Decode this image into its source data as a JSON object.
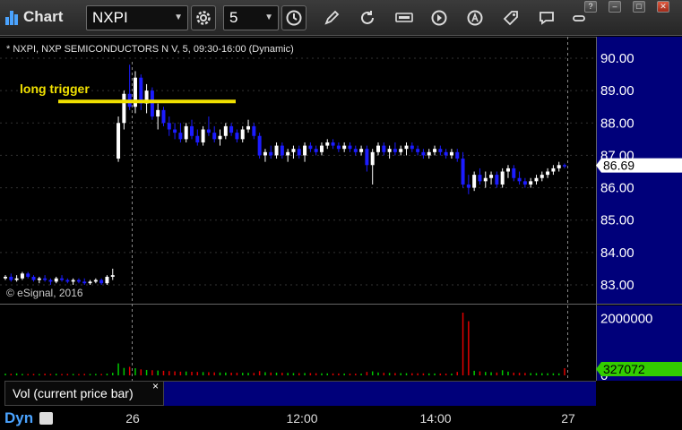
{
  "app": {
    "title": "Chart"
  },
  "toolbar": {
    "symbol": "NXPI",
    "interval": "5",
    "icons": [
      "settings-gear-icon",
      "clock-icon",
      "pencil-draw-icon",
      "refresh-icon",
      "get-data-icon",
      "play-icon",
      "alert-icon",
      "tag-icon",
      "comment-icon"
    ],
    "window_buttons": [
      "?",
      "–",
      "□",
      "✕"
    ]
  },
  "chart": {
    "title": "* NXPI, NXP SEMICONDUCTORS N V, 5, 09:30-16:00 (Dynamic)",
    "copyright": "© eSignal, 2016",
    "annotation": "long trigger",
    "last_price_label": "86.69",
    "last_volume_label": "327072"
  },
  "volume_panel": {
    "label": "Vol (current price bar)",
    "close": "×"
  },
  "bottom": {
    "mode": "Dyn",
    "time_labels": [
      "26",
      "12:00",
      "14:00",
      "27"
    ]
  },
  "colors": {
    "up": "#ffffff",
    "down": "#1c1cff",
    "vol_up": "#00c800",
    "vol_down": "#e00000",
    "annotation": "#f0e000",
    "axis_panel": "#00007a",
    "price_badge": "#ffffff",
    "volume_badge": "#33cc00",
    "accent": "#4aa3ff"
  },
  "chart_data": {
    "type": "candlestick",
    "y_ticks": [
      90.0,
      89.0,
      88.0,
      87.0,
      86.0,
      85.0,
      84.0,
      83.0
    ],
    "y_tick_labels": [
      "90.00",
      "89.00",
      "88.00",
      "87.00",
      "86.00",
      "85.00",
      "84.00",
      "83.00"
    ],
    "ylim": [
      82.5,
      90.6
    ],
    "x_labels": [
      "26",
      "12:00",
      "14:00",
      "27"
    ],
    "long_trigger_level": 88.5,
    "last_price": 86.69,
    "volume_tick_labels": [
      "2000000",
      "0"
    ],
    "volume_ticks": [
      2000000,
      0
    ],
    "volume_ylim": [
      0,
      2200000
    ],
    "last_volume": 327072,
    "candles": [
      [
        83.2,
        83.3,
        83.15,
        83.25
      ],
      [
        83.25,
        83.35,
        83.1,
        83.15
      ],
      [
        83.15,
        83.3,
        83.1,
        83.2
      ],
      [
        83.2,
        83.4,
        83.15,
        83.35
      ],
      [
        83.35,
        83.4,
        83.2,
        83.25
      ],
      [
        83.25,
        83.3,
        83.1,
        83.15
      ],
      [
        83.15,
        83.25,
        83.05,
        83.2
      ],
      [
        83.2,
        83.3,
        83.1,
        83.15
      ],
      [
        83.15,
        83.2,
        83.0,
        83.1
      ],
      [
        83.1,
        83.25,
        83.05,
        83.2
      ],
      [
        83.2,
        83.3,
        83.1,
        83.15
      ],
      [
        83.15,
        83.2,
        83.05,
        83.1
      ],
      [
        83.1,
        83.2,
        83.0,
        83.15
      ],
      [
        83.15,
        83.2,
        83.05,
        83.1
      ],
      [
        83.1,
        83.2,
        83.0,
        83.05
      ],
      [
        83.05,
        83.15,
        83.0,
        83.1
      ],
      [
        83.1,
        83.2,
        83.05,
        83.15
      ],
      [
        83.15,
        83.2,
        83.0,
        83.05
      ],
      [
        83.05,
        83.3,
        83.0,
        83.25
      ],
      [
        83.25,
        83.5,
        83.15,
        83.3
      ],
      [
        86.9,
        88.2,
        86.8,
        88.0
      ],
      [
        88.0,
        89.0,
        87.8,
        88.9
      ],
      [
        88.9,
        89.8,
        88.4,
        88.5
      ],
      [
        88.5,
        89.6,
        88.3,
        89.4
      ],
      [
        89.4,
        89.5,
        88.4,
        88.6
      ],
      [
        88.6,
        89.2,
        88.3,
        89.0
      ],
      [
        89.0,
        89.1,
        88.1,
        88.2
      ],
      [
        88.2,
        88.6,
        87.8,
        88.4
      ],
      [
        88.4,
        88.5,
        87.9,
        88.0
      ],
      [
        88.0,
        88.2,
        87.6,
        87.8
      ],
      [
        87.8,
        88.0,
        87.5,
        87.7
      ],
      [
        87.7,
        88.0,
        87.4,
        87.5
      ],
      [
        87.5,
        88.0,
        87.4,
        87.9
      ],
      [
        87.9,
        88.1,
        87.5,
        87.6
      ],
      [
        87.6,
        87.8,
        87.3,
        87.4
      ],
      [
        87.4,
        87.9,
        87.3,
        87.8
      ],
      [
        87.8,
        88.2,
        87.6,
        87.7
      ],
      [
        87.7,
        87.9,
        87.4,
        87.5
      ],
      [
        87.5,
        87.8,
        87.3,
        87.6
      ],
      [
        87.6,
        88.0,
        87.5,
        87.9
      ],
      [
        87.9,
        88.0,
        87.6,
        87.7
      ],
      [
        87.7,
        87.8,
        87.4,
        87.5
      ],
      [
        87.5,
        87.9,
        87.4,
        87.8
      ],
      [
        87.8,
        88.1,
        87.7,
        87.9
      ],
      [
        87.9,
        88.0,
        87.5,
        87.6
      ],
      [
        87.6,
        87.7,
        86.9,
        87.0
      ],
      [
        87.0,
        87.2,
        86.8,
        87.1
      ],
      [
        87.1,
        87.3,
        86.9,
        87.0
      ],
      [
        87.0,
        87.4,
        86.9,
        87.3
      ],
      [
        87.3,
        87.4,
        86.9,
        87.0
      ],
      [
        87.0,
        87.2,
        86.8,
        87.1
      ],
      [
        87.1,
        87.3,
        86.9,
        87.2
      ],
      [
        87.2,
        87.3,
        86.9,
        87.0
      ],
      [
        87.0,
        87.4,
        86.8,
        87.3
      ],
      [
        87.3,
        87.4,
        87.1,
        87.2
      ],
      [
        87.2,
        87.3,
        87.0,
        87.1
      ],
      [
        87.1,
        87.4,
        87.0,
        87.3
      ],
      [
        87.3,
        87.5,
        87.2,
        87.4
      ],
      [
        87.4,
        87.5,
        87.2,
        87.3
      ],
      [
        87.3,
        87.4,
        87.1,
        87.2
      ],
      [
        87.2,
        87.4,
        87.1,
        87.3
      ],
      [
        87.3,
        87.4,
        87.1,
        87.2
      ],
      [
        87.2,
        87.3,
        87.0,
        87.1
      ],
      [
        87.1,
        87.3,
        87.0,
        87.2
      ],
      [
        87.2,
        87.3,
        86.5,
        86.7
      ],
      [
        86.7,
        87.2,
        86.1,
        87.1
      ],
      [
        87.1,
        87.4,
        87.0,
        87.3
      ],
      [
        87.3,
        87.4,
        87.0,
        87.1
      ],
      [
        87.1,
        87.3,
        86.9,
        87.2
      ],
      [
        87.2,
        87.4,
        87.0,
        87.1
      ],
      [
        87.1,
        87.3,
        87.0,
        87.2
      ],
      [
        87.2,
        87.4,
        87.0,
        87.3
      ],
      [
        87.3,
        87.4,
        87.1,
        87.2
      ],
      [
        87.2,
        87.3,
        87.0,
        87.1
      ],
      [
        87.1,
        87.2,
        86.9,
        87.0
      ],
      [
        87.0,
        87.2,
        86.9,
        87.1
      ],
      [
        87.1,
        87.3,
        87.0,
        87.2
      ],
      [
        87.2,
        87.3,
        87.0,
        87.1
      ],
      [
        87.1,
        87.2,
        86.9,
        87.0
      ],
      [
        87.0,
        87.2,
        86.9,
        87.1
      ],
      [
        87.1,
        87.2,
        86.8,
        86.9
      ],
      [
        86.9,
        87.1,
        86.0,
        86.1
      ],
      [
        86.1,
        86.4,
        85.8,
        86.0
      ],
      [
        86.0,
        86.5,
        85.9,
        86.4
      ],
      [
        86.4,
        86.6,
        86.1,
        86.2
      ],
      [
        86.2,
        86.5,
        86.0,
        86.3
      ],
      [
        86.3,
        86.5,
        86.1,
        86.4
      ],
      [
        86.4,
        86.5,
        86.0,
        86.1
      ],
      [
        86.1,
        86.6,
        86.0,
        86.5
      ],
      [
        86.5,
        86.7,
        86.3,
        86.6
      ],
      [
        86.6,
        86.7,
        86.2,
        86.3
      ],
      [
        86.3,
        86.5,
        86.1,
        86.2
      ],
      [
        86.2,
        86.3,
        86.0,
        86.1
      ],
      [
        86.1,
        86.3,
        86.0,
        86.2
      ],
      [
        86.2,
        86.4,
        86.1,
        86.3
      ],
      [
        86.3,
        86.5,
        86.2,
        86.4
      ],
      [
        86.4,
        86.6,
        86.3,
        86.5
      ],
      [
        86.5,
        86.7,
        86.4,
        86.6
      ],
      [
        86.6,
        86.8,
        86.5,
        86.7
      ],
      [
        86.7,
        86.75,
        86.6,
        86.69
      ]
    ],
    "volumes": [
      60000,
      55000,
      70000,
      50000,
      48000,
      52000,
      45000,
      60000,
      50000,
      55000,
      48000,
      52000,
      50000,
      47000,
      53000,
      49000,
      51000,
      50000,
      60000,
      90000,
      420000,
      260000,
      300000,
      250000,
      210000,
      190000,
      180000,
      170000,
      160000,
      150000,
      140000,
      130000,
      135000,
      125000,
      120000,
      115000,
      110000,
      105000,
      100000,
      98000,
      95000,
      92000,
      90000,
      88000,
      86000,
      150000,
      110000,
      100000,
      95000,
      90000,
      85000,
      80000,
      78000,
      82000,
      80000,
      75000,
      72000,
      70000,
      68000,
      66000,
      64000,
      62000,
      60000,
      58000,
      120000,
      140000,
      100000,
      90000,
      85000,
      80000,
      78000,
      76000,
      74000,
      72000,
      70000,
      68000,
      66000,
      64000,
      62000,
      60000,
      120000,
      2200000,
      1900000,
      160000,
      140000,
      120000,
      110000,
      100000,
      180000,
      130000,
      95000,
      90000,
      85000,
      80000,
      78000,
      76000,
      74000,
      72000,
      70000,
      250000
    ]
  }
}
